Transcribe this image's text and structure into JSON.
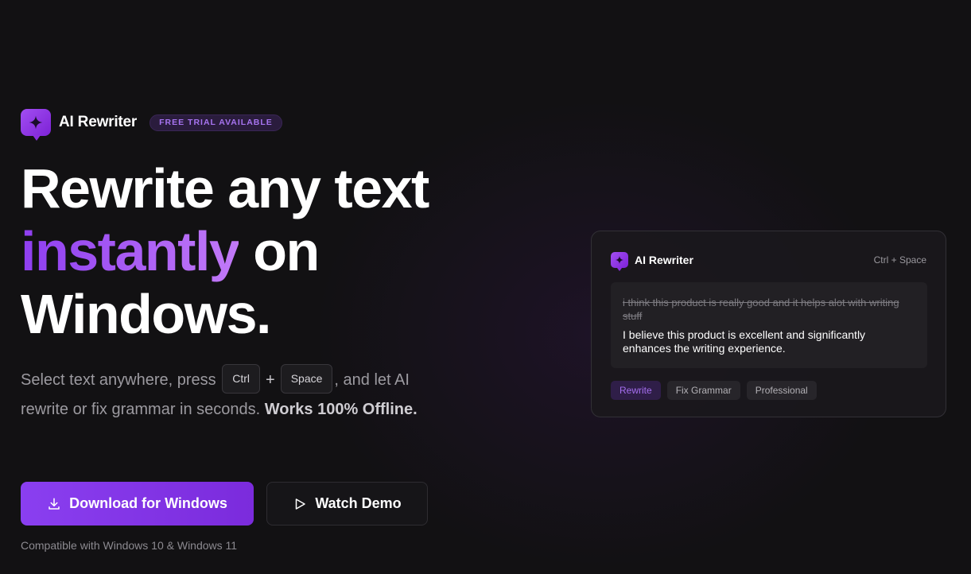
{
  "brand": {
    "name": "AI Rewriter",
    "badge": "FREE TRIAL AVAILABLE",
    "logo_icon": "sparkle-icon",
    "accent_color": "#8a3ff0"
  },
  "hero": {
    "headline_line1": "Rewrite any text",
    "headline_accent": "instantly",
    "headline_line2_rest": " on",
    "headline_line3": "Windows.",
    "sub_before": "Select text anywhere, press ",
    "key_ctrl": "Ctrl",
    "key_plus": "+",
    "key_space": "Space",
    "sub_after": ", and let AI rewrite or fix grammar in seconds. ",
    "sub_bold": "Works 100% Offline."
  },
  "actions": {
    "download_label": "Download for Windows",
    "download_icon": "download-icon",
    "demo_label": "Watch Demo",
    "demo_icon": "play-icon",
    "compat_note": "Compatible with Windows 10 & Windows 11"
  },
  "preview": {
    "title": "AI Rewriter",
    "shortcut": "Ctrl + Space",
    "original_text": "i think this product is really good and it helps alot with writing stuff",
    "rewritten_text": "I believe this product is excellent and significantly enhances the writing experience.",
    "chips": [
      "Rewrite",
      "Fix Grammar",
      "Professional"
    ],
    "active_chip": "Rewrite"
  }
}
